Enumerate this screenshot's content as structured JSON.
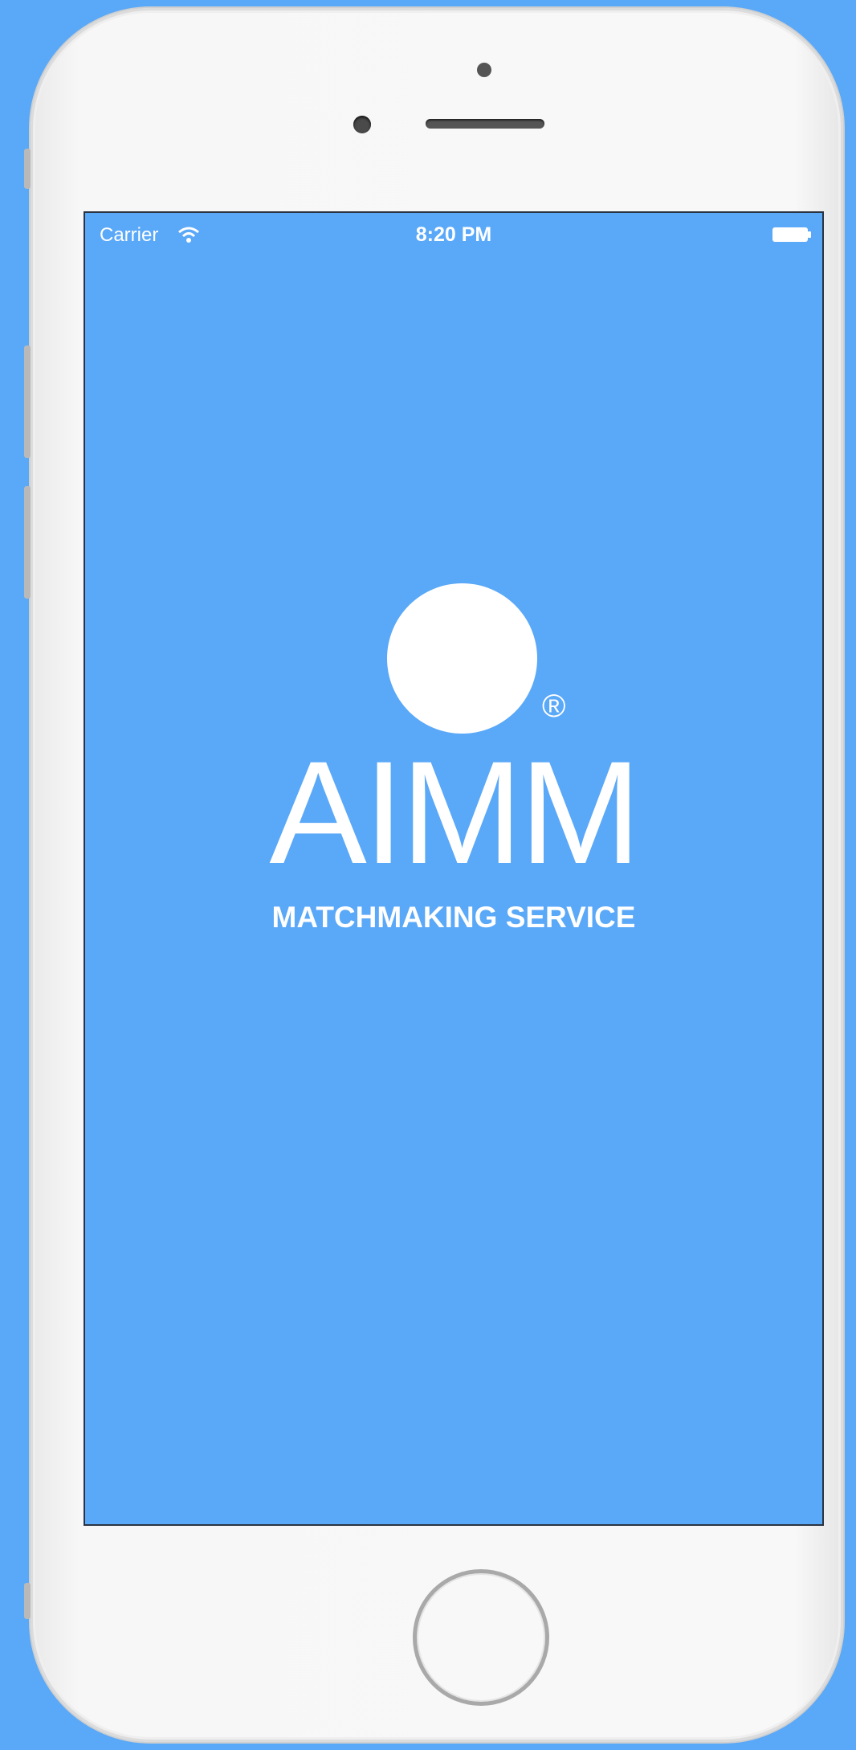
{
  "device": {
    "frame_color": "#f8f8f8",
    "screen_background": "#5aa8f8",
    "background": "#5aa8f8"
  },
  "status_bar": {
    "carrier": "Carrier",
    "time": "8:20 PM",
    "wifi_icon": "wifi-icon",
    "battery_icon": "battery-icon"
  },
  "splash": {
    "brand": "AIMM",
    "registered_mark": "®",
    "tagline": "MATCHMAKING SERVICE",
    "logo_icon": "circle-logo"
  }
}
